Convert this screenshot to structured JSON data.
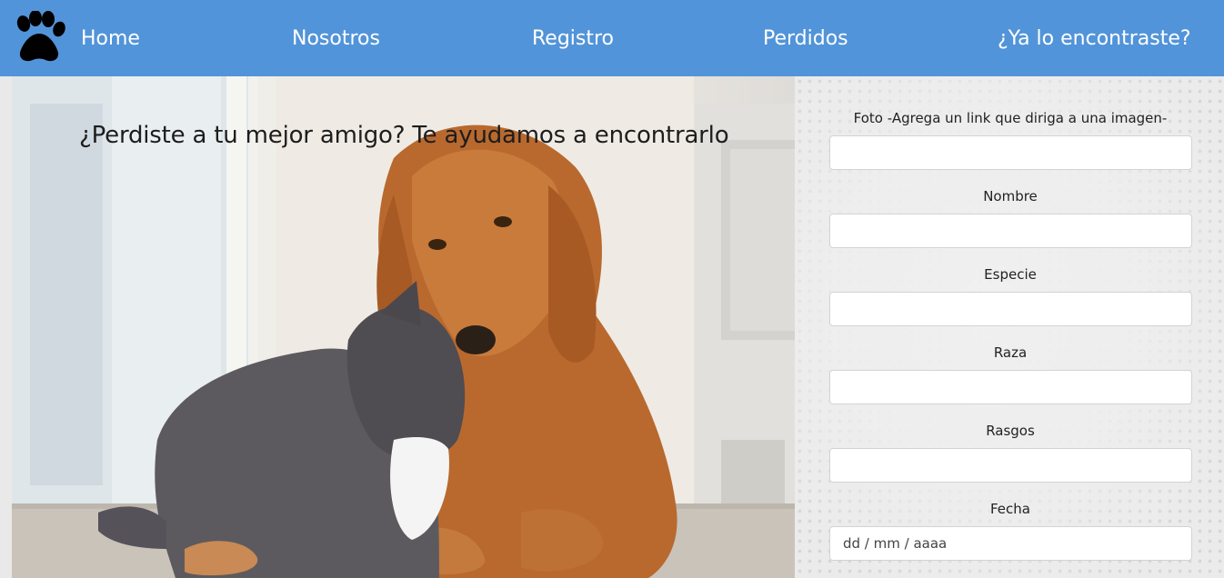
{
  "nav": {
    "logo_icon": "paw-icon",
    "items": [
      {
        "label": "Home"
      },
      {
        "label": "Nosotros"
      },
      {
        "label": "Registro"
      },
      {
        "label": "Perdidos"
      },
      {
        "label": "¿Ya lo encontraste?"
      }
    ],
    "background": "#5294d9"
  },
  "hero": {
    "title": "¿Perdiste a tu mejor amigo? Te ayudamos a encontrarlo",
    "image": "dog-and-cat-photo"
  },
  "form": {
    "fields": [
      {
        "label": "Foto -Agrega un link que diriga a una imagen-",
        "value": "",
        "placeholder": ""
      },
      {
        "label": "Nombre",
        "value": "",
        "placeholder": ""
      },
      {
        "label": "Especie",
        "value": "",
        "placeholder": ""
      },
      {
        "label": "Raza",
        "value": "",
        "placeholder": ""
      },
      {
        "label": "Rasgos",
        "value": "",
        "placeholder": ""
      },
      {
        "label": "Fecha",
        "value": "",
        "placeholder": "dd / mm / aaaa"
      }
    ]
  }
}
